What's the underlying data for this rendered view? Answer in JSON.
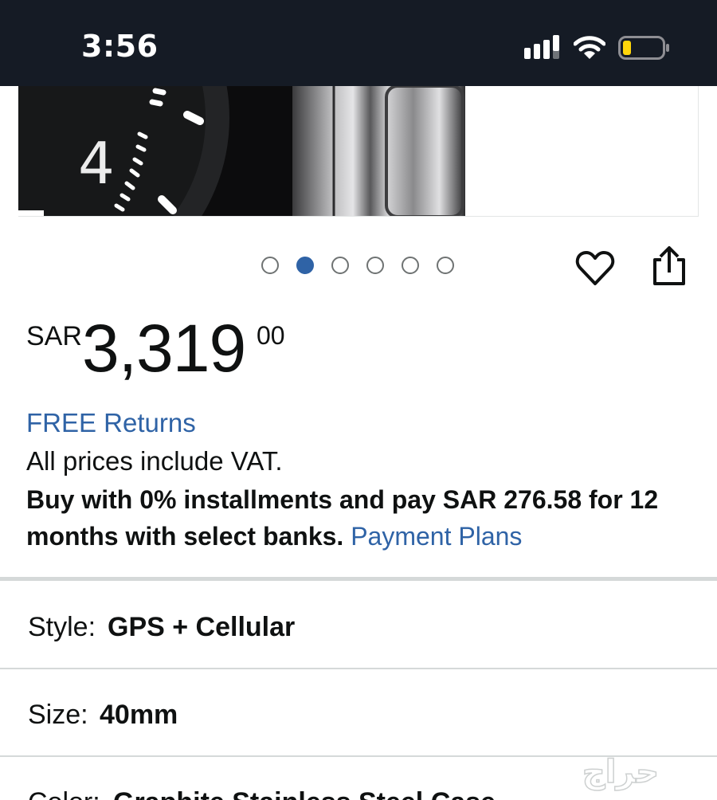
{
  "status_bar": {
    "time": "3:56"
  },
  "carousel": {
    "count": 6,
    "active_index": 1
  },
  "price": {
    "currency": "SAR",
    "whole": "3,319",
    "fraction": "00"
  },
  "free_returns": "FREE Returns",
  "vat_note": "All prices include VAT.",
  "installments": {
    "text": "Buy with 0% installments and pay SAR 276.58 for 12 months with select banks.",
    "link": "Payment Plans"
  },
  "options": {
    "style_label": "Style:",
    "style_value": "GPS + Cellular",
    "size_label": "Size:",
    "size_value": "40mm",
    "color_label": "Color:",
    "color_value": "Graphite Stainless Steel Case"
  },
  "watermark": "حراج",
  "colors": {
    "status_bar": "#151b25",
    "link": "#2f63a6",
    "active_dot": "#2f63a6",
    "battery": "#ffd60a"
  },
  "icons": [
    "signal-icon",
    "wifi-icon",
    "battery-icon",
    "heart-icon",
    "share-icon"
  ]
}
